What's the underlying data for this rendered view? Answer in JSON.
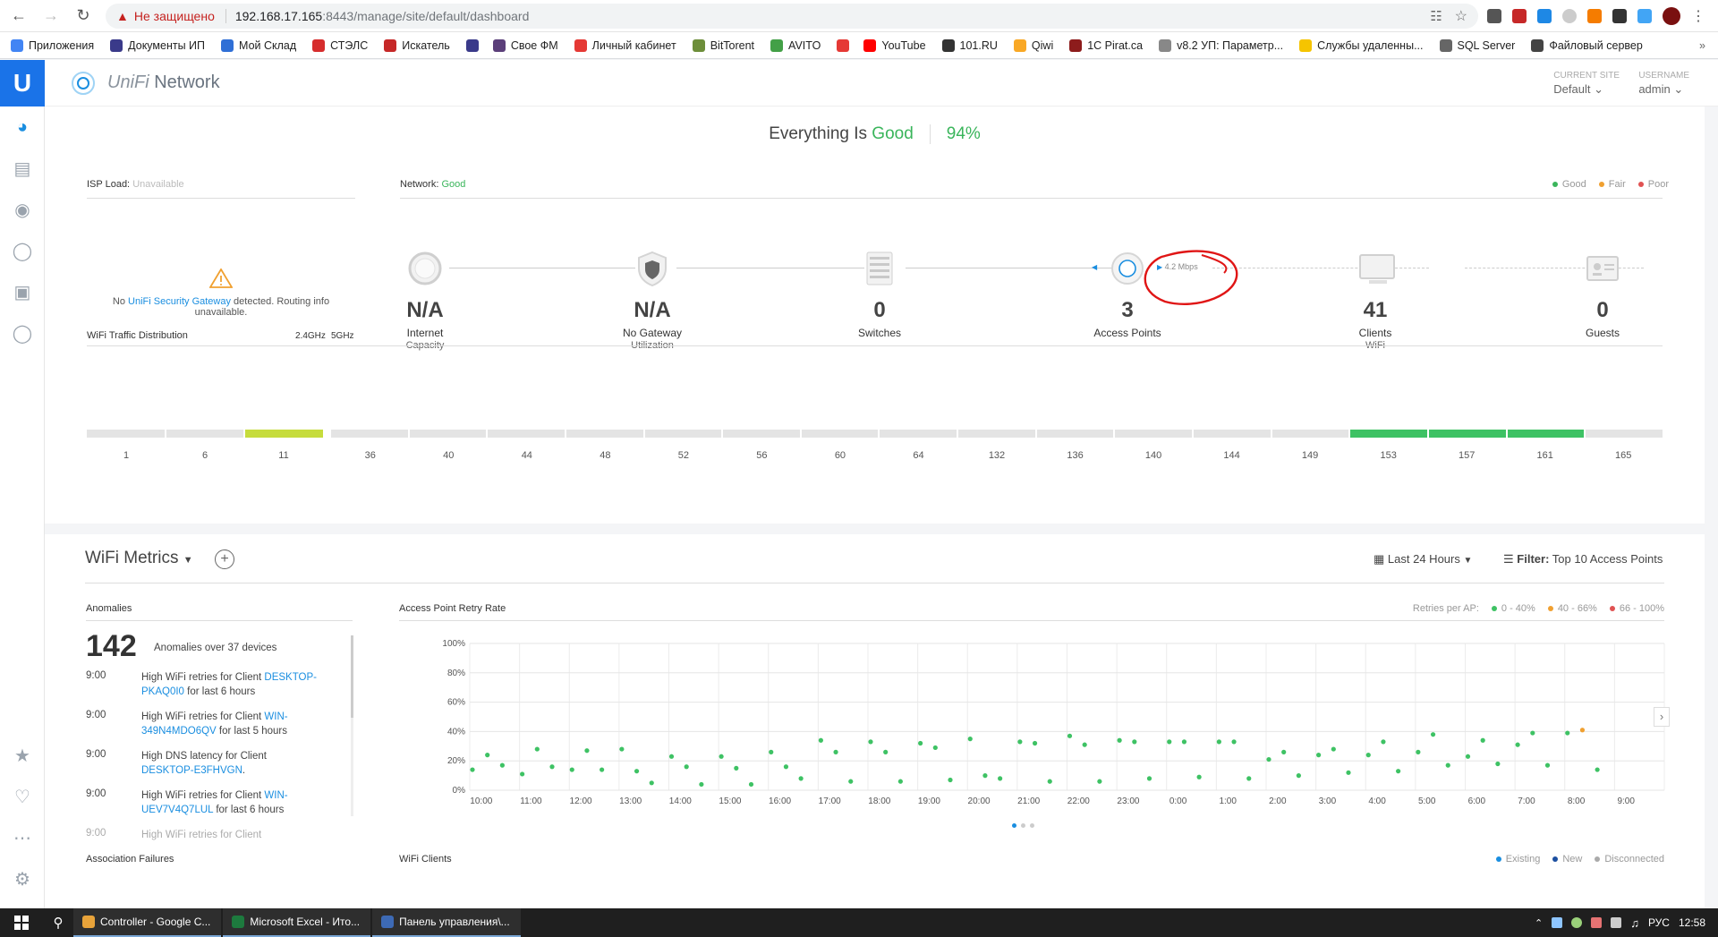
{
  "browser": {
    "insecure_label": "Не защищено",
    "url_host": "192.168.17.165",
    "url_path": ":8443/manage/site/default/dashboard"
  },
  "bookmarks": [
    {
      "label": "Приложения",
      "color": "#4285f4"
    },
    {
      "label": "Документы ИП",
      "color": "#3a3a8a"
    },
    {
      "label": "Мой Склад",
      "color": "#2f6fd6"
    },
    {
      "label": "СТЭЛС",
      "color": "#d62d2d"
    },
    {
      "label": "Искатель",
      "color": "#c62828"
    },
    {
      "label": "",
      "color": "#3a3a8a"
    },
    {
      "label": "Свое ФМ",
      "color": "#5b3f7a"
    },
    {
      "label": "Личный кабинет",
      "color": "#e53935"
    },
    {
      "label": "BitTorent",
      "color": "#6d8e3a"
    },
    {
      "label": "AVITO",
      "color": "#43a047"
    },
    {
      "label": "",
      "color": "#e53935"
    },
    {
      "label": "YouTube",
      "color": "#ff0000"
    },
    {
      "label": "101.RU",
      "color": "#333333"
    },
    {
      "label": "Qiwi",
      "color": "#f9a825"
    },
    {
      "label": "1C Pirat.ca",
      "color": "#8d1c1c"
    },
    {
      "label": "v8.2 УП: Параметр...",
      "color": "#888888"
    },
    {
      "label": "Службы удаленны...",
      "color": "#f5c400"
    },
    {
      "label": "SQL Server",
      "color": "#666666"
    },
    {
      "label": "Файловый сервер",
      "color": "#444444"
    }
  ],
  "app": {
    "brand_prefix": "UniFi",
    "brand_suffix": " Network",
    "current_site_label": "CURRENT SITE",
    "current_site_value": "Default",
    "username_label": "USERNAME",
    "username_value": "admin"
  },
  "health": {
    "prefix": "Everything Is ",
    "status": "Good",
    "percent": "94%"
  },
  "isp": {
    "label": "ISP Load:",
    "value": "Unavailable",
    "msg_prefix": "No ",
    "msg_link": "UniFi Security Gateway",
    "msg_suffix": " detected. Routing info unavailable."
  },
  "network": {
    "label": "Network:",
    "value": "Good",
    "legend": [
      {
        "label": "Good",
        "color": "#3ab55b"
      },
      {
        "label": "Fair",
        "color": "#f0a030"
      },
      {
        "label": "Poor",
        "color": "#e05252"
      }
    ],
    "throughput": "4.2 Mbps",
    "nodes": [
      {
        "value": "N/A",
        "label": "Internet",
        "sub": "Capacity",
        "icon": "globe-icon"
      },
      {
        "value": "N/A",
        "label": "No Gateway",
        "sub": "Utilization",
        "icon": "shield-icon"
      },
      {
        "value": "0",
        "label": "Switches",
        "sub": "",
        "icon": "switch-icon"
      },
      {
        "value": "3",
        "label": "Access Points",
        "sub": "",
        "icon": "access-point-icon"
      },
      {
        "value": "41",
        "label": "Clients",
        "sub": "WiFi",
        "icon": "monitor-icon"
      },
      {
        "value": "0",
        "label": "Guests",
        "sub": "",
        "icon": "guest-badge-icon"
      }
    ]
  },
  "wifi_traffic": {
    "title": "WiFi Traffic Distribution",
    "band24": "2.4GHz",
    "band5": "5GHz",
    "channels24": [
      "1",
      "6",
      "11"
    ],
    "channels5": [
      "36",
      "40",
      "44",
      "48",
      "52",
      "56",
      "60",
      "64",
      "132",
      "136",
      "140",
      "144",
      "149",
      "153",
      "157",
      "161",
      "165"
    ],
    "active24": [
      "11"
    ],
    "active5": [
      "153",
      "157",
      "161"
    ],
    "color24": "#c6dc3c",
    "color5": "#3ec264"
  },
  "metrics": {
    "title": "WiFi Metrics",
    "range": "Last 24 Hours",
    "filter_label": "Filter:",
    "filter_value": "Top 10 Access Points"
  },
  "anomalies": {
    "title": "Anomalies",
    "count": "142",
    "count_text": "Anomalies over 37 devices",
    "items": [
      {
        "time": "9:00",
        "pre": "High WiFi retries for Client ",
        "link": "DESKTOP-PKAQ0I0",
        "post": " for last 6 hours"
      },
      {
        "time": "9:00",
        "pre": "High WiFi retries for Client ",
        "link": "WIN-349N4MDO6QV",
        "post": " for last 5 hours"
      },
      {
        "time": "9:00",
        "pre": "High DNS latency for Client ",
        "link": "DESKTOP-E3FHVGN",
        "post": "."
      },
      {
        "time": "9:00",
        "pre": "High WiFi retries for Client ",
        "link": "WIN-UEV7V4Q7LUL",
        "post": " for last 6 hours"
      },
      {
        "time": "9:00",
        "pre": "High WiFi retries for Client",
        "link": "",
        "post": ""
      }
    ]
  },
  "retry_chart": {
    "title": "Access Point Retry Rate",
    "legend_title": "Retries per AP:",
    "legend": [
      {
        "label": "0 - 40%",
        "color": "#3ec264"
      },
      {
        "label": "40 - 66%",
        "color": "#f0a030"
      },
      {
        "label": "66 - 100%",
        "color": "#e05252"
      }
    ]
  },
  "bottom": {
    "assoc_title": "Association Failures",
    "clients_title": "WiFi Clients",
    "legend": [
      {
        "label": "Existing",
        "color": "#1a8ee0"
      },
      {
        "label": "New",
        "color": "#1c4fa0"
      },
      {
        "label": "Disconnected",
        "color": "#aaaaaa"
      }
    ]
  },
  "taskbar": {
    "items": [
      {
        "label": "Controller - Google C...",
        "color": "#e8a33a"
      },
      {
        "label": "Microsoft Excel - Ито...",
        "color": "#1d7a3e"
      },
      {
        "label": "Панель управления\\...",
        "color": "#3d6ab5"
      }
    ],
    "lang": "РУС",
    "clock": "12:58"
  },
  "chart_data": {
    "type": "scatter",
    "title": "Access Point Retry Rate",
    "xlabel": "",
    "ylabel": "",
    "ylim": [
      0,
      100
    ],
    "yticks": [
      "0%",
      "20%",
      "40%",
      "60%",
      "80%",
      "100%"
    ],
    "xticks": [
      "10:00",
      "11:00",
      "12:00",
      "13:00",
      "14:00",
      "15:00",
      "16:00",
      "17:00",
      "18:00",
      "19:00",
      "20:00",
      "21:00",
      "22:00",
      "23:00",
      "0:00",
      "1:00",
      "2:00",
      "3:00",
      "4:00",
      "5:00",
      "6:00",
      "7:00",
      "8:00",
      "9:00"
    ],
    "points": [
      [
        0.0,
        14,
        "green"
      ],
      [
        0.3,
        24,
        "green"
      ],
      [
        0.6,
        17,
        "green"
      ],
      [
        1.0,
        11,
        "green"
      ],
      [
        1.3,
        28,
        "green"
      ],
      [
        1.6,
        16,
        "green"
      ],
      [
        2.0,
        14,
        "green"
      ],
      [
        2.3,
        27,
        "green"
      ],
      [
        2.6,
        14,
        "green"
      ],
      [
        3.0,
        28,
        "green"
      ],
      [
        3.3,
        13,
        "green"
      ],
      [
        3.6,
        5,
        "green"
      ],
      [
        4.0,
        23,
        "green"
      ],
      [
        4.3,
        16,
        "green"
      ],
      [
        4.6,
        4,
        "green"
      ],
      [
        5.0,
        23,
        "green"
      ],
      [
        5.3,
        15,
        "green"
      ],
      [
        5.6,
        4,
        "green"
      ],
      [
        6.0,
        26,
        "green"
      ],
      [
        6.3,
        16,
        "green"
      ],
      [
        6.6,
        8,
        "green"
      ],
      [
        7.0,
        34,
        "green"
      ],
      [
        7.3,
        26,
        "green"
      ],
      [
        7.6,
        6,
        "green"
      ],
      [
        8.0,
        33,
        "green"
      ],
      [
        8.3,
        26,
        "green"
      ],
      [
        8.6,
        6,
        "green"
      ],
      [
        9.0,
        32,
        "green"
      ],
      [
        9.3,
        29,
        "green"
      ],
      [
        9.6,
        7,
        "green"
      ],
      [
        10.0,
        35,
        "green"
      ],
      [
        10.3,
        10,
        "green"
      ],
      [
        10.6,
        8,
        "green"
      ],
      [
        11.0,
        33,
        "green"
      ],
      [
        11.3,
        32,
        "green"
      ],
      [
        11.6,
        6,
        "green"
      ],
      [
        12.0,
        37,
        "green"
      ],
      [
        12.3,
        31,
        "green"
      ],
      [
        12.6,
        6,
        "green"
      ],
      [
        13.0,
        34,
        "green"
      ],
      [
        13.3,
        33,
        "green"
      ],
      [
        13.6,
        8,
        "green"
      ],
      [
        14.0,
        33,
        "green"
      ],
      [
        14.3,
        33,
        "green"
      ],
      [
        14.6,
        9,
        "green"
      ],
      [
        15.0,
        33,
        "green"
      ],
      [
        15.3,
        33,
        "green"
      ],
      [
        15.6,
        8,
        "green"
      ],
      [
        16.0,
        21,
        "green"
      ],
      [
        16.3,
        26,
        "green"
      ],
      [
        16.6,
        10,
        "green"
      ],
      [
        17.0,
        24,
        "green"
      ],
      [
        17.3,
        28,
        "green"
      ],
      [
        17.6,
        12,
        "green"
      ],
      [
        18.0,
        24,
        "green"
      ],
      [
        18.3,
        33,
        "green"
      ],
      [
        18.6,
        13,
        "green"
      ],
      [
        19.0,
        26,
        "green"
      ],
      [
        19.3,
        38,
        "green"
      ],
      [
        19.6,
        17,
        "green"
      ],
      [
        20.0,
        23,
        "green"
      ],
      [
        20.3,
        34,
        "green"
      ],
      [
        20.6,
        18,
        "green"
      ],
      [
        21.0,
        31,
        "green"
      ],
      [
        21.3,
        39,
        "green"
      ],
      [
        21.6,
        17,
        "green"
      ],
      [
        22.0,
        39,
        "green"
      ],
      [
        22.3,
        41,
        "orange"
      ],
      [
        22.6,
        14,
        "green"
      ]
    ]
  }
}
